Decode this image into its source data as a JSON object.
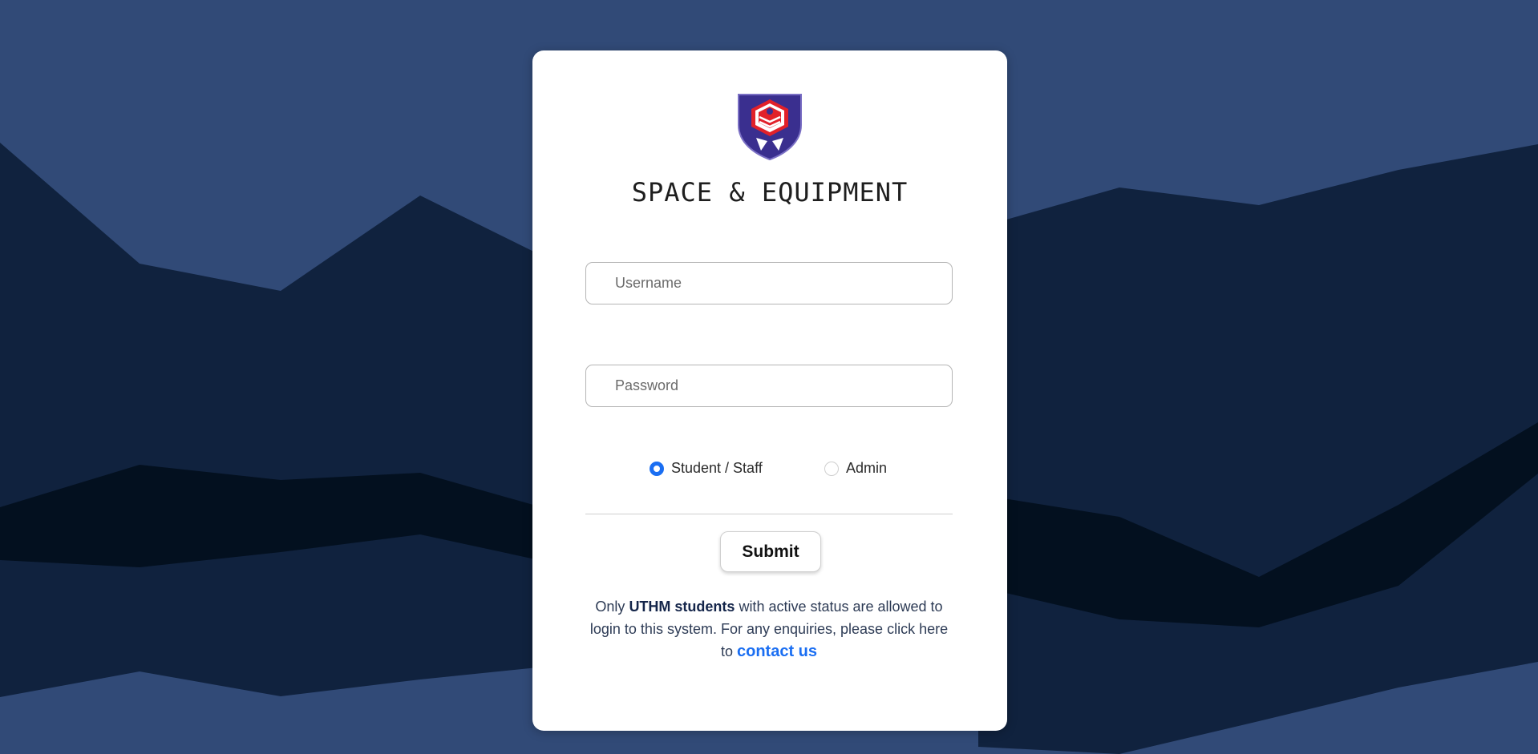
{
  "app": {
    "title": "SPACE & EQUIPMENT"
  },
  "form": {
    "username_placeholder": "Username",
    "password_placeholder": "Password",
    "username_value": "",
    "password_value": "",
    "role_options": [
      {
        "label": "Student / Staff",
        "selected": true
      },
      {
        "label": "Admin",
        "selected": false
      }
    ],
    "submit_label": "Submit"
  },
  "notice": {
    "prefix": "Only ",
    "highlight": "UTHM students",
    "middle": " with active status are allowed to login to this system. For any enquiries, please click here to ",
    "link_label": "contact us"
  },
  "colors": {
    "background": "#314a77",
    "mountain_dark": "#10223e",
    "mountain_darkest": "#03101f",
    "accent": "#1a6ef2",
    "logo_blue": "#3a2f8f",
    "logo_red": "#e1212a"
  },
  "icons": {
    "logo": "uthm-shield-logo"
  }
}
